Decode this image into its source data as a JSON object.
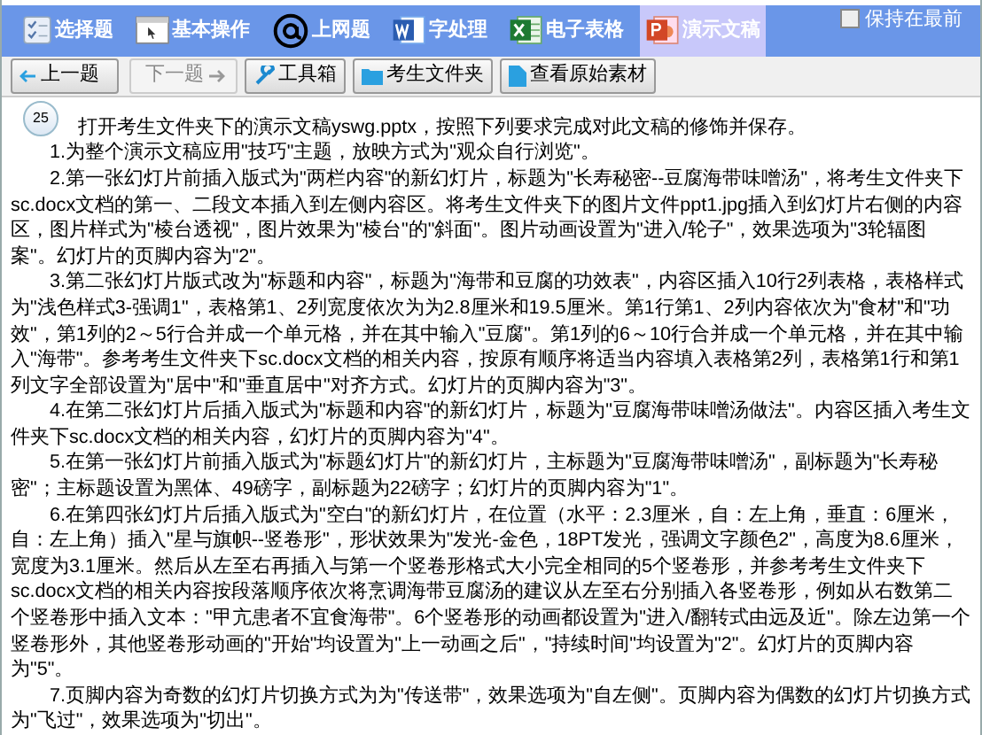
{
  "tabs": [
    {
      "label": "选择题",
      "selected": false
    },
    {
      "label": "基本操作",
      "selected": false
    },
    {
      "label": "上网题",
      "selected": false
    },
    {
      "label": "字处理",
      "selected": false
    },
    {
      "label": "电子表格",
      "selected": false
    },
    {
      "label": "演示文稿",
      "selected": true
    }
  ],
  "keep_on_top": {
    "label": "保持在最前",
    "checked": false
  },
  "toolbar": [
    {
      "label": "上一题",
      "kind": "prev",
      "disabled": false
    },
    {
      "label": "下一题",
      "kind": "next",
      "disabled": true
    },
    {
      "label": "工具箱",
      "kind": "tools",
      "disabled": false
    },
    {
      "label": "考生文件夹",
      "kind": "folder",
      "disabled": false
    },
    {
      "label": "查看原始素材",
      "kind": "file",
      "disabled": false
    }
  ],
  "question": {
    "number": "25",
    "paragraphs": [
      "打开考生文件夹下的演示文稿yswg.pptx，按照下列要求完成对此文稿的修饰并保存。",
      "1.为整个演示文稿应用\"技巧\"主题，放映方式为\"观众自行浏览\"。",
      "2.第一张幻灯片前插入版式为\"两栏内容\"的新幻灯片，标题为\"长寿秘密--豆腐海带味噌汤\"，将考生文件夹下sc.docx文档的第一、二段文本插入到左侧内容区。将考生文件夹下的图片文件ppt1.jpg插入到幻灯片右侧的内容区，图片样式为\"棱台透视\"，图片效果为\"棱台\"的\"斜面\"。图片动画设置为\"进入/轮子\"，效果选项为\"3轮辐图案\"。幻灯片的页脚内容为\"2\"。",
      "3.第二张幻灯片版式改为\"标题和内容\"，标题为\"海带和豆腐的功效表\"，内容区插入10行2列表格，表格样式为\"浅色样式3-强调1\"，表格第1、2列宽度依次为为2.8厘米和19.5厘米。第1行第1、2列内容依次为\"食材\"和\"功效\"，第1列的2～5行合并成一个单元格，并在其中输入\"豆腐\"。第1列的6～10行合并成一个单元格，并在其中输入\"海带\"。参考考生文件夹下sc.docx文档的相关内容，按原有顺序将适当内容填入表格第2列，表格第1行和第1列文字全部设置为\"居中\"和\"垂直居中\"对齐方式。幻灯片的页脚内容为\"3\"。",
      "4.在第二张幻灯片后插入版式为\"标题和内容\"的新幻灯片，标题为\"豆腐海带味噌汤做法\"。内容区插入考生文件夹下sc.docx文档的相关内容，幻灯片的页脚内容为\"4\"。",
      "5.在第一张幻灯片前插入版式为\"标题幻灯片\"的新幻灯片，主标题为\"豆腐海带味噌汤\"，副标题为\"长寿秘密\"；主标题设置为黑体、49磅字，副标题为22磅字；幻灯片的页脚内容为\"1\"。",
      "6.在第四张幻灯片后插入版式为\"空白\"的新幻灯片，在位置（水平：2.3厘米，自：左上角，垂直：6厘米，自：左上角）插入\"星与旗帜--竖卷形\"，形状效果为\"发光-金色，18PT发光，强调文字颜色2\"，高度为8.6厘米，宽度为3.1厘米。然后从左至右再插入与第一个竖卷形格式大小完全相同的5个竖卷形，并参考考生文件夹下sc.docx文档的相关内容按段落顺序依次将烹调海带豆腐汤的建议从左至右分别插入各竖卷形，例如从右数第二个竖卷形中插入文本：\"甲亢患者不宜食海带\"。6个竖卷形的动画都设置为\"进入/翻转式由远及近\"。除左边第一个竖卷形外，其他竖卷形动画的\"开始\"均设置为\"上一动画之后\"，\"持续时间\"均设置为\"2\"。幻灯片的页脚内容为\"5\"。",
      "7.页脚内容为奇数的幻灯片切换方式为为\"传送带\"，效果选项为\"自左侧\"。页脚内容为偶数的幻灯片切换方式为\"飞过\"，效果选项为\"切出\"。"
    ]
  }
}
